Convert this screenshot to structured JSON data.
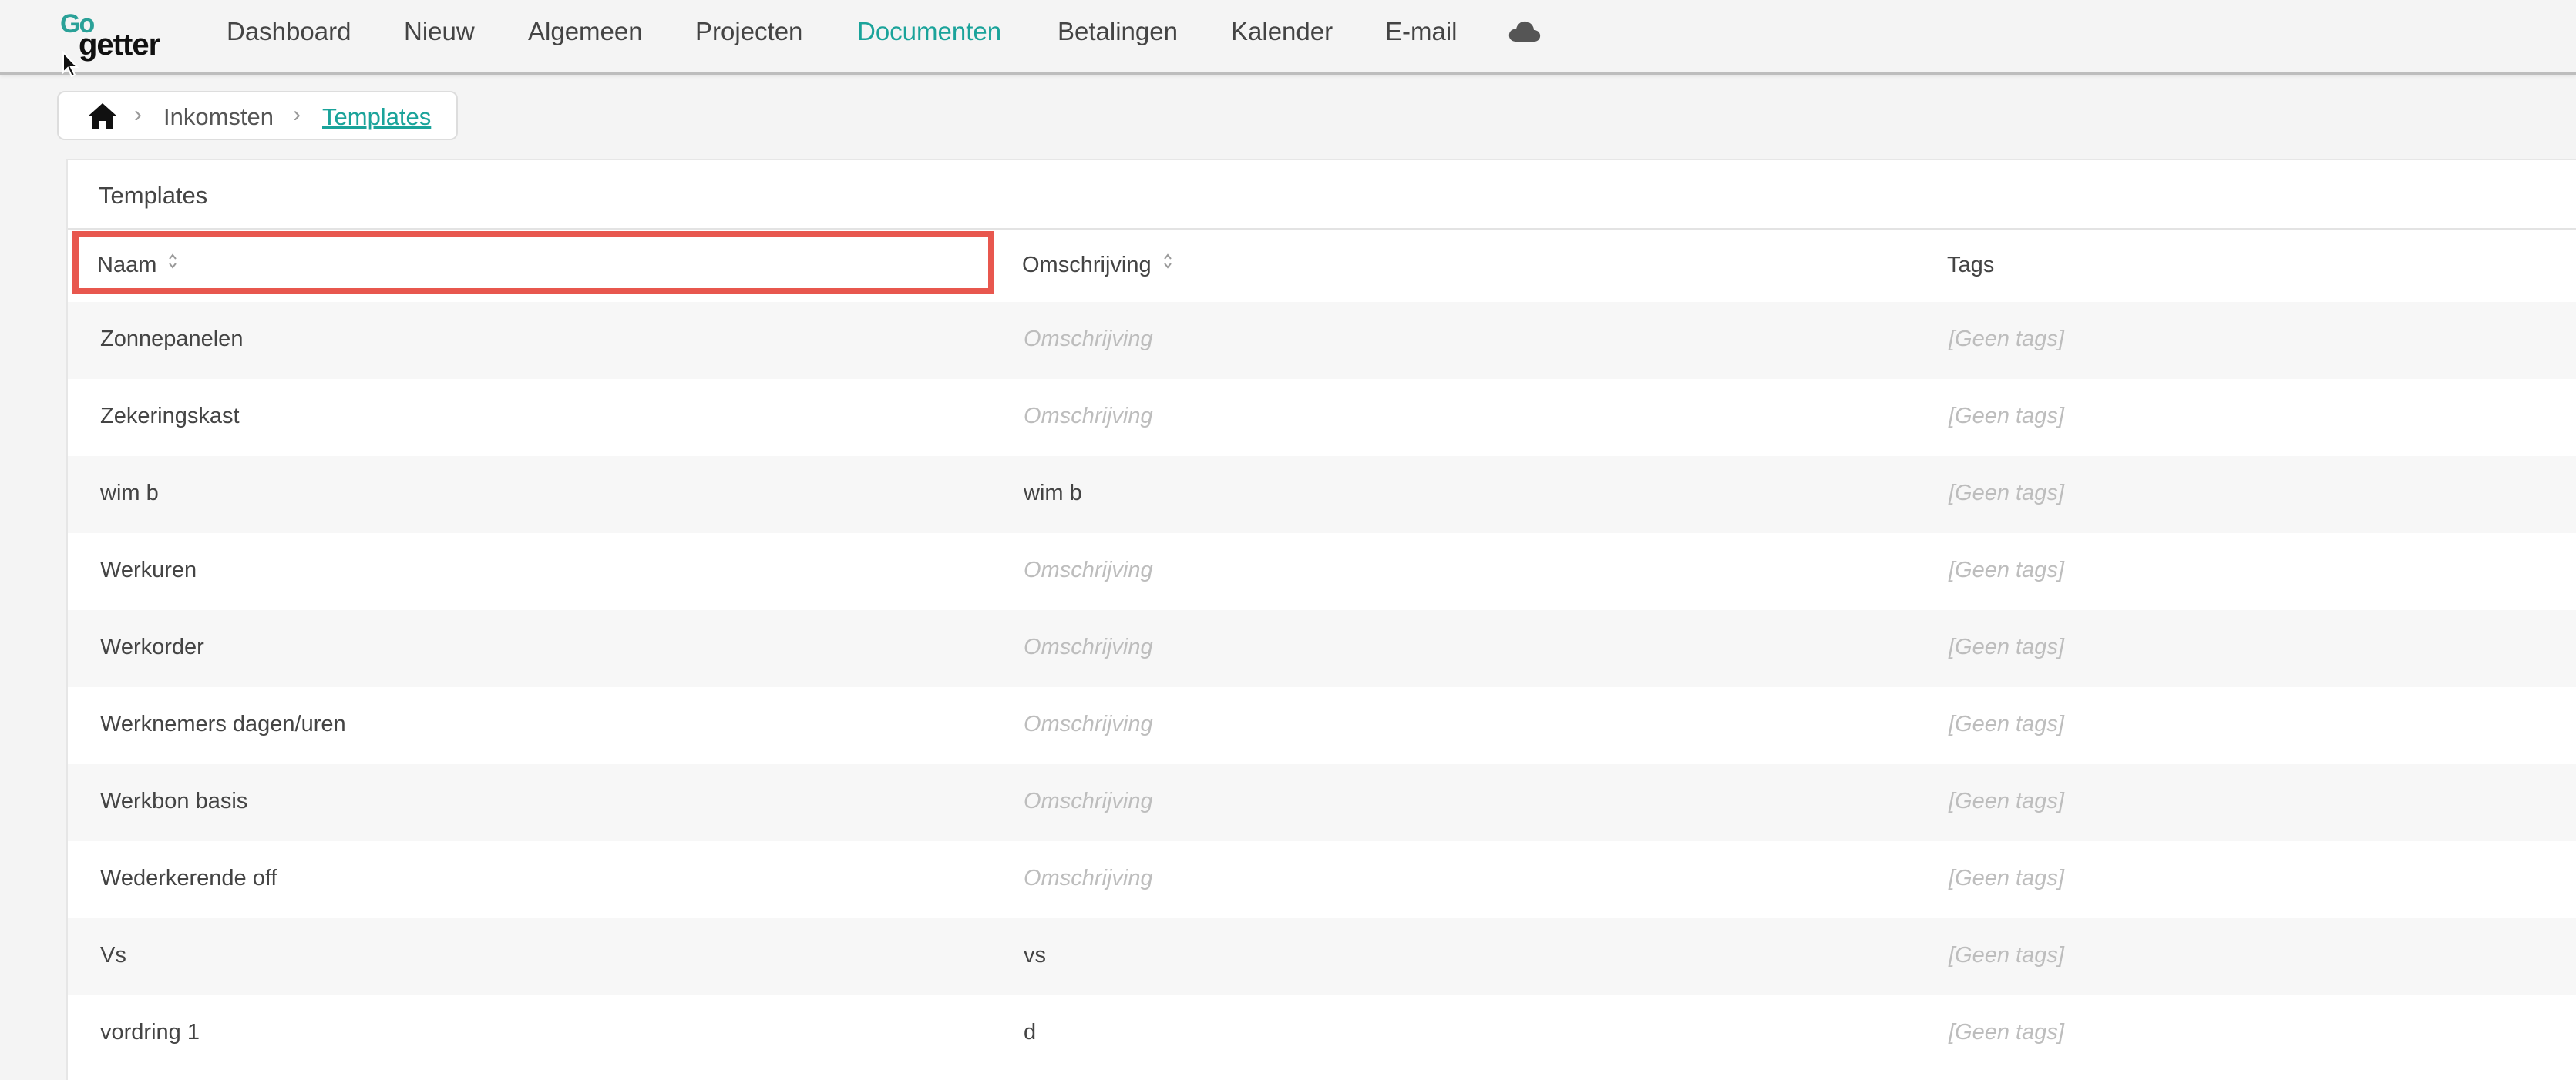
{
  "logo": {
    "top": "Go",
    "bottom": "getter"
  },
  "nav": {
    "items": [
      {
        "label": "Dashboard",
        "active": false
      },
      {
        "label": "Nieuw",
        "active": false
      },
      {
        "label": "Algemeen",
        "active": false
      },
      {
        "label": "Projecten",
        "active": false
      },
      {
        "label": "Documenten",
        "active": true
      },
      {
        "label": "Betalingen",
        "active": false
      },
      {
        "label": "Kalender",
        "active": false
      },
      {
        "label": "E-mail",
        "active": false
      }
    ],
    "cloud_icon": "cloud-icon"
  },
  "breadcrumb": {
    "home_icon": "home-icon",
    "items": [
      {
        "label": "Inkomsten"
      },
      {
        "label": "Templates"
      }
    ]
  },
  "table": {
    "title": "Templates",
    "columns": {
      "naam": "Naam",
      "omschrijving": "Omschrijving",
      "tags": "Tags"
    },
    "rows": [
      {
        "naam": "Zonnepanelen",
        "omschrijving": "Omschrijving",
        "omschrijving_is_placeholder": true,
        "tags": "[Geen tags]"
      },
      {
        "naam": "Zekeringskast",
        "omschrijving": "Omschrijving",
        "omschrijving_is_placeholder": true,
        "tags": "[Geen tags]"
      },
      {
        "naam": "wim b",
        "omschrijving": "wim b",
        "omschrijving_is_placeholder": false,
        "tags": "[Geen tags]"
      },
      {
        "naam": "Werkuren",
        "omschrijving": "Omschrijving",
        "omschrijving_is_placeholder": true,
        "tags": "[Geen tags]"
      },
      {
        "naam": "Werkorder",
        "omschrijving": "Omschrijving",
        "omschrijving_is_placeholder": true,
        "tags": "[Geen tags]"
      },
      {
        "naam": "Werknemers dagen/uren",
        "omschrijving": "Omschrijving",
        "omschrijving_is_placeholder": true,
        "tags": "[Geen tags]"
      },
      {
        "naam": "Werkbon basis",
        "omschrijving": "Omschrijving",
        "omschrijving_is_placeholder": true,
        "tags": "[Geen tags]"
      },
      {
        "naam": "Wederkerende off",
        "omschrijving": "Omschrijving",
        "omschrijving_is_placeholder": true,
        "tags": "[Geen tags]"
      },
      {
        "naam": "Vs",
        "omschrijving": "vs",
        "omschrijving_is_placeholder": false,
        "tags": "[Geen tags]"
      },
      {
        "naam": "vordring 1",
        "omschrijving": "d",
        "omschrijving_is_placeholder": false,
        "tags": "[Geen tags]"
      }
    ]
  },
  "colors": {
    "accent": "#1aa39a",
    "highlight": "#e8574e",
    "placeholder": "#bdbdbd"
  }
}
